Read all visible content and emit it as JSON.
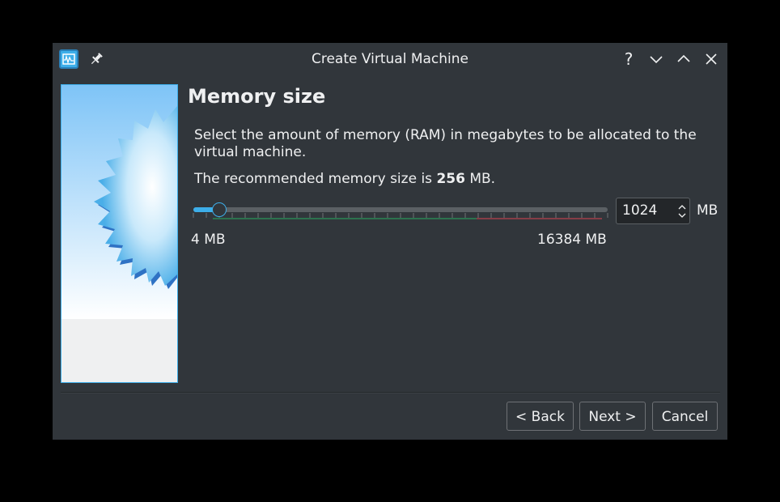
{
  "window": {
    "title": "Create Virtual Machine",
    "app_icon": "virtualbox-icon",
    "pin_icon": "pin-icon",
    "help_label": "?"
  },
  "page": {
    "heading": "Memory size",
    "description": "Select the amount of memory (RAM) in megabytes to be allocated to the virtual machine.",
    "recommend_prefix": "The recommended memory size is ",
    "recommend_value": "256",
    "recommend_suffix": " MB."
  },
  "memory": {
    "value": "1024",
    "value_mb": 1024,
    "min_mb": 4,
    "max_mb": 16384,
    "unit": "MB",
    "min_label": "4 MB",
    "max_label": "16384 MB"
  },
  "buttons": {
    "back": "< Back",
    "next": "Next >",
    "cancel": "Cancel"
  },
  "colors": {
    "accent": "#3daee9",
    "background": "#31363b",
    "text": "#eff0f1",
    "tick_green": "#27ae60",
    "tick_red": "#da4453"
  }
}
